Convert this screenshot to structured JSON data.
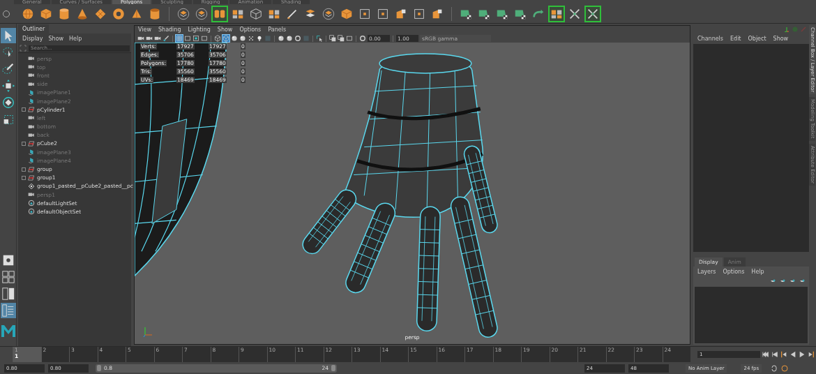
{
  "shelf": {
    "tabs": [
      {
        "label": "General",
        "selected": false
      },
      {
        "label": "Curves / Surfaces",
        "selected": false
      },
      {
        "label": "Polygons",
        "selected": true
      },
      {
        "label": "Sculpting",
        "selected": false
      },
      {
        "label": "Rigging",
        "selected": false
      },
      {
        "label": "Animation",
        "selected": false
      },
      {
        "label": "Shading",
        "selected": false
      }
    ],
    "groups": [
      [
        {
          "kind": "sphere",
          "highlighted": false
        },
        {
          "kind": "cube",
          "highlighted": false
        },
        {
          "kind": "cylinder",
          "highlighted": false
        },
        {
          "kind": "cone",
          "highlighted": false
        },
        {
          "kind": "plane",
          "highlighted": false
        },
        {
          "kind": "torus",
          "highlighted": false
        },
        {
          "kind": "pyramid",
          "highlighted": false
        },
        {
          "kind": "pipe",
          "highlighted": false
        }
      ],
      [
        {
          "kind": "layers",
          "highlighted": false
        },
        {
          "kind": "layers",
          "highlighted": false
        },
        {
          "kind": "pair",
          "highlighted": true
        },
        {
          "kind": "checker",
          "highlighted": false
        },
        {
          "kind": "wirecube",
          "highlighted": false
        },
        {
          "kind": "checker",
          "highlighted": false
        },
        {
          "kind": "knife",
          "highlighted": false
        },
        {
          "kind": "stack",
          "highlighted": false
        },
        {
          "kind": "layers",
          "highlighted": false
        },
        {
          "kind": "cube",
          "highlighted": false
        },
        {
          "kind": "frame",
          "highlighted": false
        },
        {
          "kind": "frame",
          "highlighted": false
        },
        {
          "kind": "split",
          "highlighted": false
        },
        {
          "kind": "frame",
          "highlighted": false
        },
        {
          "kind": "split",
          "highlighted": false
        }
      ],
      [
        {
          "kind": "mesh",
          "highlighted": false
        },
        {
          "kind": "mesh",
          "highlighted": false
        },
        {
          "kind": "mesh",
          "highlighted": false
        },
        {
          "kind": "mesh",
          "highlighted": false
        },
        {
          "kind": "curve",
          "highlighted": false
        },
        {
          "kind": "checker",
          "highlighted": true
        },
        {
          "kind": "cross",
          "highlighted": false
        },
        {
          "kind": "cross",
          "highlighted": true
        }
      ]
    ]
  },
  "toolbox": {
    "tools": [
      {
        "kind": "select",
        "selected": true
      },
      {
        "kind": "lasso",
        "selected": false
      },
      {
        "kind": "paint",
        "selected": false
      },
      {
        "kind": "move",
        "selected": false
      },
      {
        "kind": "rotate",
        "selected": false
      },
      {
        "kind": "scale",
        "selected": false
      }
    ],
    "layouts": [
      {
        "kind": "single",
        "selected": false
      },
      {
        "kind": "quad",
        "selected": false
      },
      {
        "kind": "split",
        "selected": false
      },
      {
        "kind": "outliner",
        "selected": true
      }
    ]
  },
  "outliner": {
    "tab": "Outliner",
    "menu": [
      "Display",
      "Show",
      "Help"
    ],
    "search": {
      "placeholder": "Search..."
    },
    "items": [
      {
        "label": "persp",
        "kind": "camera",
        "dimmed": true,
        "collapsed": false
      },
      {
        "label": "top",
        "kind": "camera",
        "dimmed": true,
        "collapsed": false
      },
      {
        "label": "front",
        "kind": "camera",
        "dimmed": true,
        "collapsed": false
      },
      {
        "label": "side",
        "kind": "camera",
        "dimmed": true,
        "collapsed": false
      },
      {
        "label": "imagePlane1",
        "kind": "imageplane",
        "dimmed": true,
        "collapsed": false
      },
      {
        "label": "imagePlane2",
        "kind": "imageplane",
        "dimmed": true,
        "collapsed": false
      },
      {
        "label": "pCylinder1",
        "kind": "transform",
        "dimmed": false,
        "collapsed": true
      },
      {
        "label": "left",
        "kind": "camera",
        "dimmed": true,
        "collapsed": false
      },
      {
        "label": "bottom",
        "kind": "camera",
        "dimmed": true,
        "collapsed": false
      },
      {
        "label": "back",
        "kind": "camera",
        "dimmed": true,
        "collapsed": false
      },
      {
        "label": "pCube2",
        "kind": "transform",
        "dimmed": false,
        "collapsed": true
      },
      {
        "label": "imagePlane3",
        "kind": "imageplane",
        "dimmed": true,
        "collapsed": false
      },
      {
        "label": "imagePlane4",
        "kind": "imageplane",
        "dimmed": true,
        "collapsed": false
      },
      {
        "label": "group",
        "kind": "transform",
        "dimmed": false,
        "collapsed": true
      },
      {
        "label": "group1",
        "kind": "transform",
        "dimmed": false,
        "collapsed": true
      },
      {
        "label": "group1_pasted__pCube2_pasted__pc",
        "kind": "locator",
        "dimmed": false,
        "collapsed": false
      },
      {
        "label": "persp1",
        "kind": "camera",
        "dimmed": true,
        "collapsed": false
      },
      {
        "label": "defaultLightSet",
        "kind": "set",
        "dimmed": false,
        "collapsed": false
      },
      {
        "label": "defaultObjectSet",
        "kind": "set",
        "dimmed": false,
        "collapsed": false
      }
    ]
  },
  "viewport": {
    "menu": [
      "View",
      "Shading",
      "Lighting",
      "Show",
      "Options",
      "Panels"
    ],
    "groups": [
      [
        {
          "kind": "camera",
          "on": false
        },
        {
          "kind": "camera",
          "on": false
        },
        {
          "kind": "camera",
          "on": false
        },
        {
          "kind": "brush",
          "on": false
        }
      ],
      [
        {
          "kind": "grid",
          "on": true
        },
        {
          "kind": "frame",
          "on": false
        },
        {
          "kind": "dot",
          "on": false
        },
        {
          "kind": "frame",
          "on": false
        }
      ],
      [
        {
          "kind": "cube",
          "on": false
        },
        {
          "kind": "cube",
          "on": true
        },
        {
          "kind": "sphere",
          "on": false
        },
        {
          "kind": "sphere",
          "on": false
        },
        {
          "kind": "dots",
          "on": false
        },
        {
          "kind": "light",
          "on": false
        },
        {
          "kind": "square",
          "on": false
        }
      ],
      [
        {
          "kind": "sphere",
          "on": false
        },
        {
          "kind": "sphere",
          "on": false
        },
        {
          "kind": "ring",
          "on": false
        },
        {
          "kind": "square",
          "on": false
        }
      ],
      [
        {
          "kind": "cursor",
          "on": false
        }
      ],
      [
        {
          "kind": "copy",
          "on": false
        },
        {
          "kind": "copy",
          "on": false
        },
        {
          "kind": "frame",
          "on": false
        }
      ],
      [
        {
          "kind": "ring",
          "on": false
        }
      ]
    ],
    "exposure": "0.00",
    "gamma": "1.00",
    "color_space": "sRGB gamma",
    "hud": [
      {
        "label": "Verts:",
        "values": [
          "17927",
          "17927",
          "0"
        ]
      },
      {
        "label": "Edges:",
        "values": [
          "35706",
          "35706",
          "0"
        ]
      },
      {
        "label": "Polygons:",
        "values": [
          "17780",
          "17780",
          "0"
        ]
      },
      {
        "label": "Tris:",
        "values": [
          "35560",
          "35560",
          "0"
        ]
      },
      {
        "label": "UVs:",
        "values": [
          "18469",
          "18469",
          "0"
        ]
      }
    ],
    "camera": "persp"
  },
  "channel_box": {
    "menu": [
      "Channels",
      "Edit",
      "Object",
      "Show"
    ]
  },
  "layer_editor": {
    "tabs": [
      {
        "label": "Display",
        "selected": true
      },
      {
        "label": "Anim",
        "selected": false
      }
    ],
    "menu": [
      "Layers",
      "Options",
      "Help"
    ]
  },
  "side_tabs": [
    {
      "label": "Channel Box / Layer Editor",
      "selected": true
    },
    {
      "label": "Modeling Toolkit",
      "selected": false
    },
    {
      "label": "Attribute Editor",
      "selected": false
    }
  ],
  "timeline": {
    "frames": [
      "1",
      "2",
      "3",
      "4",
      "5",
      "6",
      "7",
      "8",
      "9",
      "10",
      "11",
      "12",
      "13",
      "14",
      "15",
      "16",
      "17",
      "18",
      "19",
      "20",
      "21",
      "22",
      "23",
      "24"
    ],
    "current": "1",
    "level": 0,
    "frame_field": "1"
  },
  "range": {
    "start": "0.80",
    "playback_start": "0.80",
    "slider_start": "0.8",
    "slider_end": "24",
    "level": 1,
    "playback_end": "24",
    "end": "48",
    "anim_layer": "No Anim Layer",
    "fps": "24 fps"
  }
}
